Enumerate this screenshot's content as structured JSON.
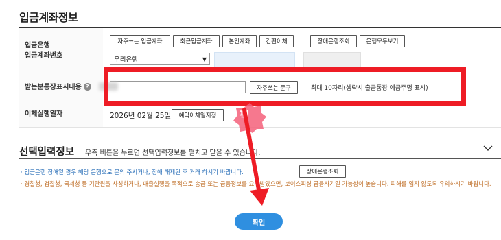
{
  "section": {
    "title": "입금계좌정보"
  },
  "account_row": {
    "label_line1": "입금은행",
    "label_line2": "입금계좌번호",
    "buttons": [
      "자주쓰는 입금계좌",
      "최근입금계좌",
      "본인계좌",
      "간편이체",
      "장애은행조회",
      "은행모두보기"
    ],
    "bank_select": "우리은행"
  },
  "memo_row": {
    "label": "받는분통장표시내용",
    "help_icon": "?",
    "button": "자주쓰는 문구",
    "hint": "최대 10자리(생략시 출금통장 예금주명 표시)"
  },
  "date_row": {
    "label": "이체실행일자",
    "date": "2026년 02월 25일",
    "button": "예약이체일지정"
  },
  "optional": {
    "title": "선택입력정보",
    "desc": "우측 버튼을 누르면 선택입력정보를 펼치고 닫을 수 있습니다.",
    "note1": "· 입금은행 장애일 경우 해당 은행으로 문의 주시거나, 장애 해제된 후 거래 하시기 바랍니다.",
    "note1_button": "장애은행조회",
    "note2": "· 경찰청, 검찰청, 국세청 등 기관원을 사칭하거나, 대출실행을 목적으로 송금 또는 금융정보를 요구받았으면, 보이스피싱 금융사기일 가능성이 높습니다. 피해를 입지 않도록 유의하시기 바랍니다."
  },
  "confirm_label": "확인",
  "overlay": {
    "badge_text": "픽",
    "highlight_color": "#ee1c25"
  }
}
